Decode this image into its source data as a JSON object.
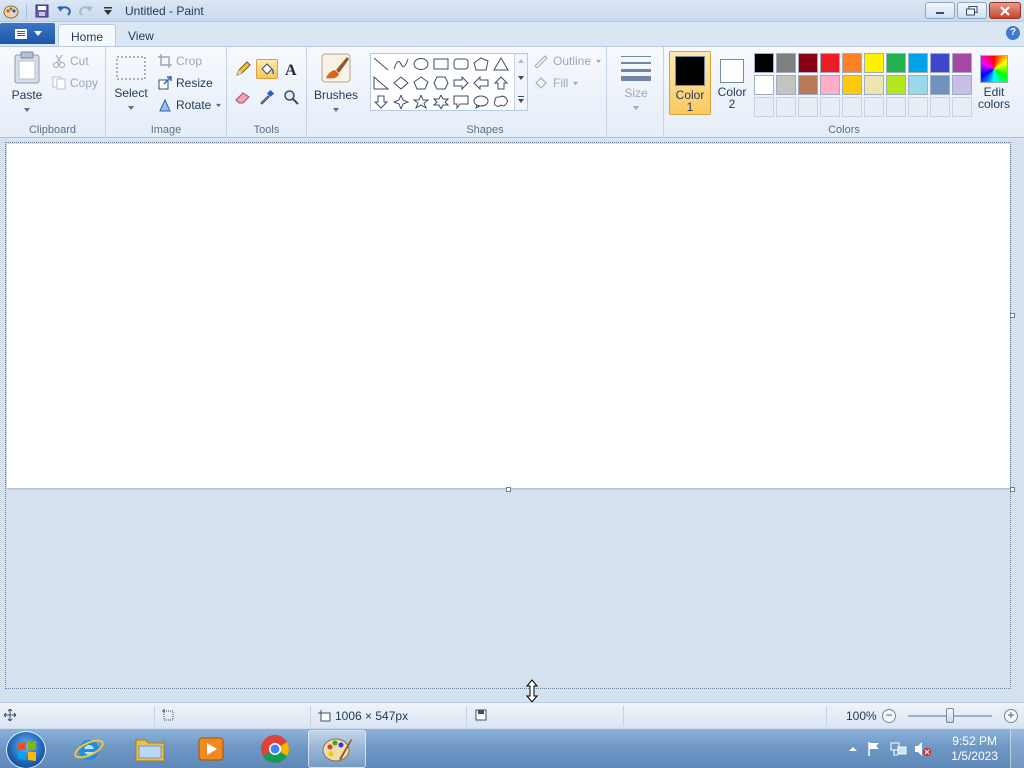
{
  "window": {
    "title": "Untitled - Paint"
  },
  "tabs": {
    "home": "Home",
    "view": "View"
  },
  "clipboard": {
    "paste": "Paste",
    "cut": "Cut",
    "copy": "Copy",
    "group": "Clipboard"
  },
  "image": {
    "select": "Select",
    "crop": "Crop",
    "resize": "Resize",
    "rotate": "Rotate",
    "group": "Image"
  },
  "tools": {
    "group": "Tools"
  },
  "brushes": {
    "label": "Brushes"
  },
  "shapes": {
    "outline": "Outline",
    "fill": "Fill",
    "group": "Shapes"
  },
  "size": {
    "label": "Size"
  },
  "colors": {
    "color1_line1": "Color",
    "color1_line2": "1",
    "color2_line1": "Color",
    "color2_line2": "2",
    "edit_line1": "Edit",
    "edit_line2": "colors",
    "group": "Colors",
    "color1_value": "#000000",
    "color2_value": "#ffffff",
    "palette_row1": [
      "#000000",
      "#7f7f7f",
      "#880015",
      "#ed1c24",
      "#ff7f27",
      "#fff200",
      "#22b14c",
      "#00a2e8",
      "#3f48cc",
      "#a349a4"
    ],
    "palette_row2": [
      "#ffffff",
      "#c3c3c3",
      "#b97a57",
      "#ffaec9",
      "#ffc90e",
      "#efe4b0",
      "#b5e61d",
      "#99d9ea",
      "#7092be",
      "#c8bfe7"
    ]
  },
  "status": {
    "dimensions": "1006 × 547px",
    "zoom": "100%"
  },
  "taskbar": {
    "time": "9:52 PM",
    "date": "1/5/2023"
  }
}
